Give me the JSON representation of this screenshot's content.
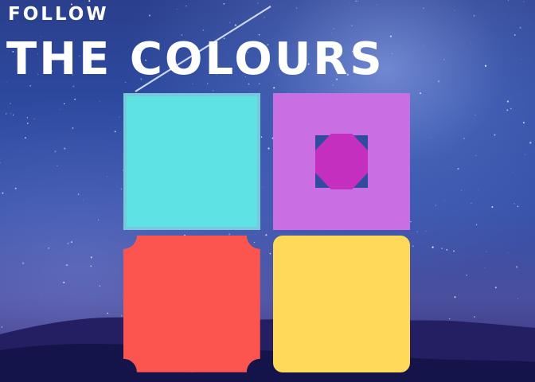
{
  "header": {
    "subtitle": "FOLLOW",
    "title": "THE COLOURS"
  },
  "board": {
    "tiles": [
      {
        "name": "cyan",
        "color": "#5fe2e2",
        "border_color": "#79c9dc",
        "shape": "square"
      },
      {
        "name": "purple",
        "color": "#c96ee3",
        "shape": "square-with-octagon-cutout",
        "inner_color": "#c52fc0"
      },
      {
        "name": "red",
        "color": "#fc5550",
        "shape": "square-with-notched-corners"
      },
      {
        "name": "yellow",
        "color": "#ffda5a",
        "shape": "rounded-square"
      }
    ]
  },
  "background": {
    "scene": "starry night sky with shooting star and hills",
    "sky_color": "#2c4aa0",
    "hill_color": "#14144a"
  }
}
